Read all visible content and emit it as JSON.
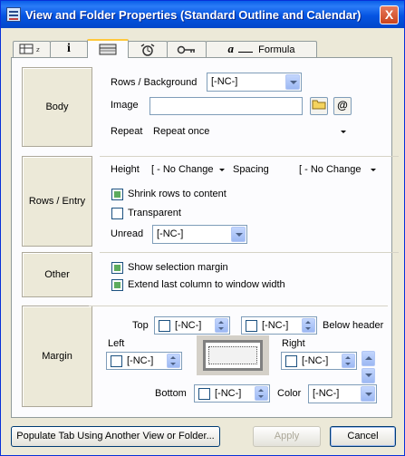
{
  "window": {
    "title": "View and Folder Properties (Standard Outline and Calendar)",
    "close_label": "X"
  },
  "tabs": [
    {
      "icon": "outline-grid-icon"
    },
    {
      "icon": "info-icon",
      "label": "i"
    },
    {
      "icon": "outline-style-icon"
    },
    {
      "icon": "calendar-icon"
    },
    {
      "icon": "key-icon"
    },
    {
      "icon": "formula-icon",
      "label": "Formula"
    }
  ],
  "body": {
    "label": "Body",
    "rows_background_label": "Rows / Background",
    "rows_background_value": "[-NC-]",
    "image_label": "Image",
    "image_value": "",
    "at_label": "@",
    "repeat_label": "Repeat",
    "repeat_value": "Repeat once"
  },
  "rows_entry": {
    "label": "Rows / Entry",
    "height_label": "Height",
    "height_value": "[ - No Change",
    "spacing_label": "Spacing",
    "spacing_value": "[ - No Change",
    "shrink_label": "Shrink rows to content",
    "shrink_checked": true,
    "transparent_label": "Transparent",
    "transparent_checked": false,
    "unread_label": "Unread",
    "unread_value": "[-NC-]"
  },
  "other": {
    "label": "Other",
    "show_margin_label": "Show selection margin",
    "show_margin_checked": true,
    "extend_label": "Extend last column to window width",
    "extend_checked": true
  },
  "margin": {
    "label": "Margin",
    "top_label": "Top",
    "top_value": "[-NC-]",
    "below_header_value": "[-NC-]",
    "below_header_label": "Below header",
    "left_label": "Left",
    "left_value": "[-NC-]",
    "right_label": "Right",
    "right_value": "[-NC-]",
    "bottom_label": "Bottom",
    "bottom_value": "[-NC-]",
    "color_label": "Color",
    "color_value": "[-NC-]"
  },
  "footer": {
    "populate_label": "Populate Tab Using Another View or Folder...",
    "apply_label": "Apply",
    "cancel_label": "Cancel"
  }
}
